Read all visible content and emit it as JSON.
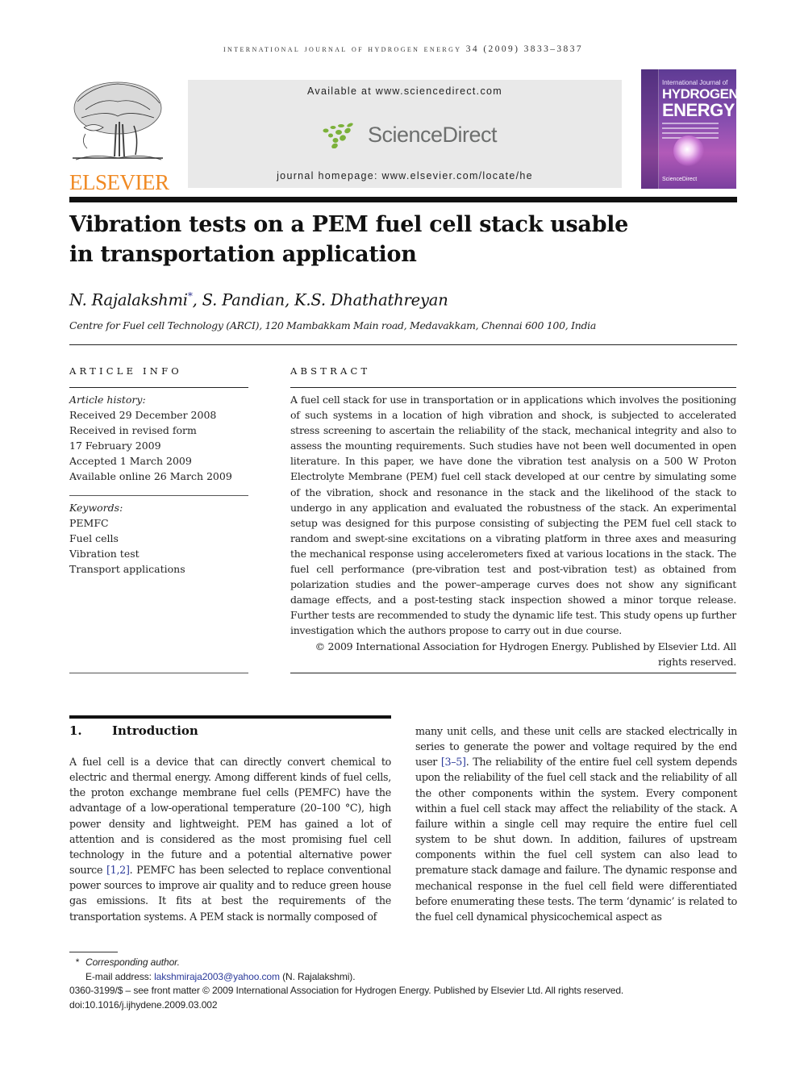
{
  "running_head": "International Journal of Hydrogen Energy 34 (2009) 3833–3837",
  "publisher_logo": {
    "name": "ELSEVIER",
    "icon": "elsevier-tree-icon",
    "color": "#f08a24"
  },
  "banner": {
    "available_at": "Available at www.sciencedirect.com",
    "logo_text": "ScienceDirect",
    "logo_icon": "sciencedirect-dots-icon",
    "logo_accent": "#7cb13a",
    "homepage": "journal homepage: www.elsevier.com/locate/he"
  },
  "cover": {
    "line1": "International Journal of",
    "line2": "HYDROGEN",
    "line3": "ENERGY",
    "footer": "ScienceDirect"
  },
  "article": {
    "title": "Vibration tests on a PEM fuel cell stack usable in transportation application",
    "authors": [
      {
        "name": "N. Rajalakshmi",
        "mark": "*"
      },
      {
        "name": "S. Pandian",
        "mark": ""
      },
      {
        "name": "K.S. Dhathathreyan",
        "mark": ""
      }
    ],
    "affiliation": "Centre for Fuel cell Technology (ARCI), 120 Mambakkam Main road, Medavakkam, Chennai 600 100, India"
  },
  "article_info": {
    "label": "ARTICLE INFO",
    "history_label": "Article history:",
    "history": [
      "Received 29 December 2008",
      "Received in revised form",
      "17 February 2009",
      "Accepted 1 March 2009",
      "Available online 26 March 2009"
    ],
    "keywords_label": "Keywords:",
    "keywords": [
      "PEMFC",
      "Fuel cells",
      "Vibration test",
      "Transport applications"
    ]
  },
  "abstract": {
    "label": "ABSTRACT",
    "text": "A fuel cell stack for use in transportation or in applications which involves the positioning of such systems in a location of high vibration and shock, is subjected to accelerated stress screening to ascertain the reliability of the stack, mechanical integrity and also to assess the mounting requirements. Such studies have not been well documented in open literature. In this paper, we have done the vibration test analysis on a 500 W Proton Electrolyte Membrane (PEM) fuel cell stack developed at our centre by simulating some of the vibration, shock and resonance in the stack and the likelihood of the stack to undergo in any application and evaluated the robustness of the stack. An experimental setup was designed for this purpose consisting of subjecting the PEM fuel cell stack to random and swept-sine excitations on a vibrating platform in three axes and measuring the mechanical response using accelerometers fixed at various locations in the stack. The fuel cell performance (pre-vibration test and post-vibration test) as obtained from polarization studies and the power–amperage curves does not show any significant damage effects, and a post-testing stack inspection showed a minor torque release. Further tests are recommended to study the dynamic life test. This study opens up further investigation which the authors propose to carry out in due course.",
    "copyright": "© 2009 International Association for Hydrogen Energy. Published by Elsevier Ltd. All rights reserved."
  },
  "introduction": {
    "number": "1.",
    "heading": "Introduction",
    "left_before_ref": "A fuel cell is a device that can directly convert chemical to electric and thermal energy. Among different kinds of fuel cells, the proton exchange membrane fuel cells (PEMFC) have the advantage of a low-operational temperature (20–100 °C), high power density and lightweight. PEM has gained a lot of attention and is considered as the most promising fuel cell technology in the future and a potential alternative power source ",
    "left_ref": "[1,2]",
    "left_after_ref": ". PEMFC has been selected to replace conventional power sources to improve air quality and to reduce green house gas emissions. It fits at best the requirements of the transportation systems. A PEM stack is normally composed of",
    "right_before_ref": "many unit cells, and these unit cells are stacked electrically in series to generate the power and voltage required by the end user ",
    "right_ref": "[3–5]",
    "right_after_ref": ". The reliability of the entire fuel cell system depends upon the reliability of the fuel cell stack and the reliability of all the other components within the system. Every component within a fuel cell stack may affect the reliability of the stack. A failure within a single cell may require the entire fuel cell system to be shut down. In addition, failures of upstream components within the fuel cell system can also lead to premature stack damage and failure. The dynamic response and mechanical response in the fuel cell field were differentiated before enumerating these tests. The term ‘dynamic’ is related to the fuel cell dynamical physicochemical aspect as"
  },
  "footnotes": {
    "star": "*",
    "corresponding": "Corresponding author.",
    "email_label": "E-mail address: ",
    "email": "lakshmiraja2003@yahoo.com",
    "email_owner": " (N. Rajalakshmi).",
    "front_matter": "0360-3199/$ – see front matter © 2009 International Association for Hydrogen Energy. Published by Elsevier Ltd. All rights reserved.",
    "doi": "doi:10.1016/j.ijhydene.2009.03.002"
  }
}
